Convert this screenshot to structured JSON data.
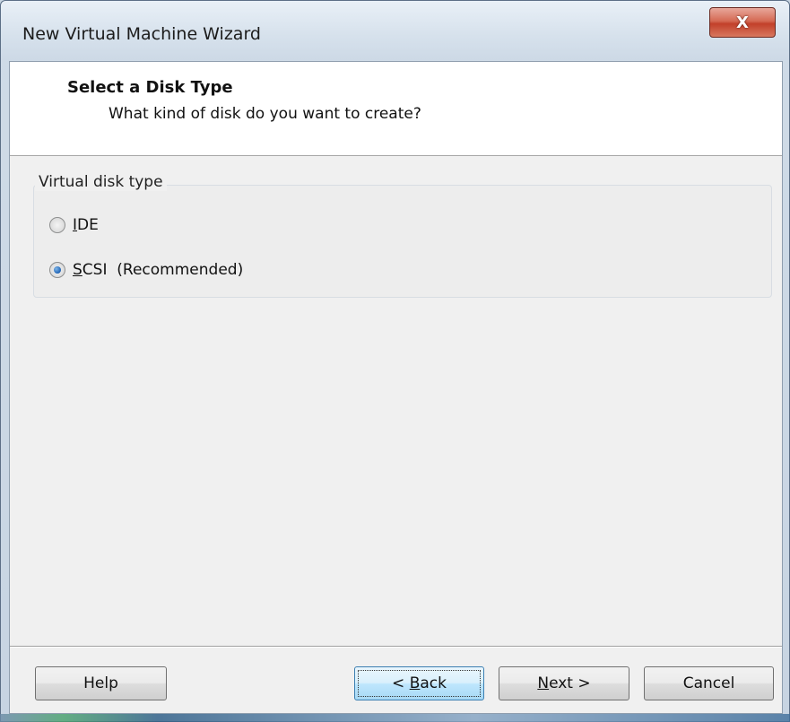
{
  "window": {
    "title": "New Virtual Machine Wizard",
    "close_label": "X"
  },
  "header": {
    "title": "Select a Disk Type",
    "subtitle": "What kind of disk do you want to create?"
  },
  "disk_type_group": {
    "label": "Virtual disk type",
    "options": [
      {
        "mnemonic": "I",
        "rest": "DE",
        "suffix": "",
        "selected": false
      },
      {
        "mnemonic": "S",
        "rest": "CSI",
        "suffix": "  (Recommended)",
        "selected": true
      }
    ]
  },
  "buttons": {
    "help": "Help",
    "back_prefix": "< ",
    "back_mnemonic": "B",
    "back_rest": "ack",
    "next_mnemonic": "N",
    "next_rest": "ext >",
    "cancel": "Cancel"
  }
}
